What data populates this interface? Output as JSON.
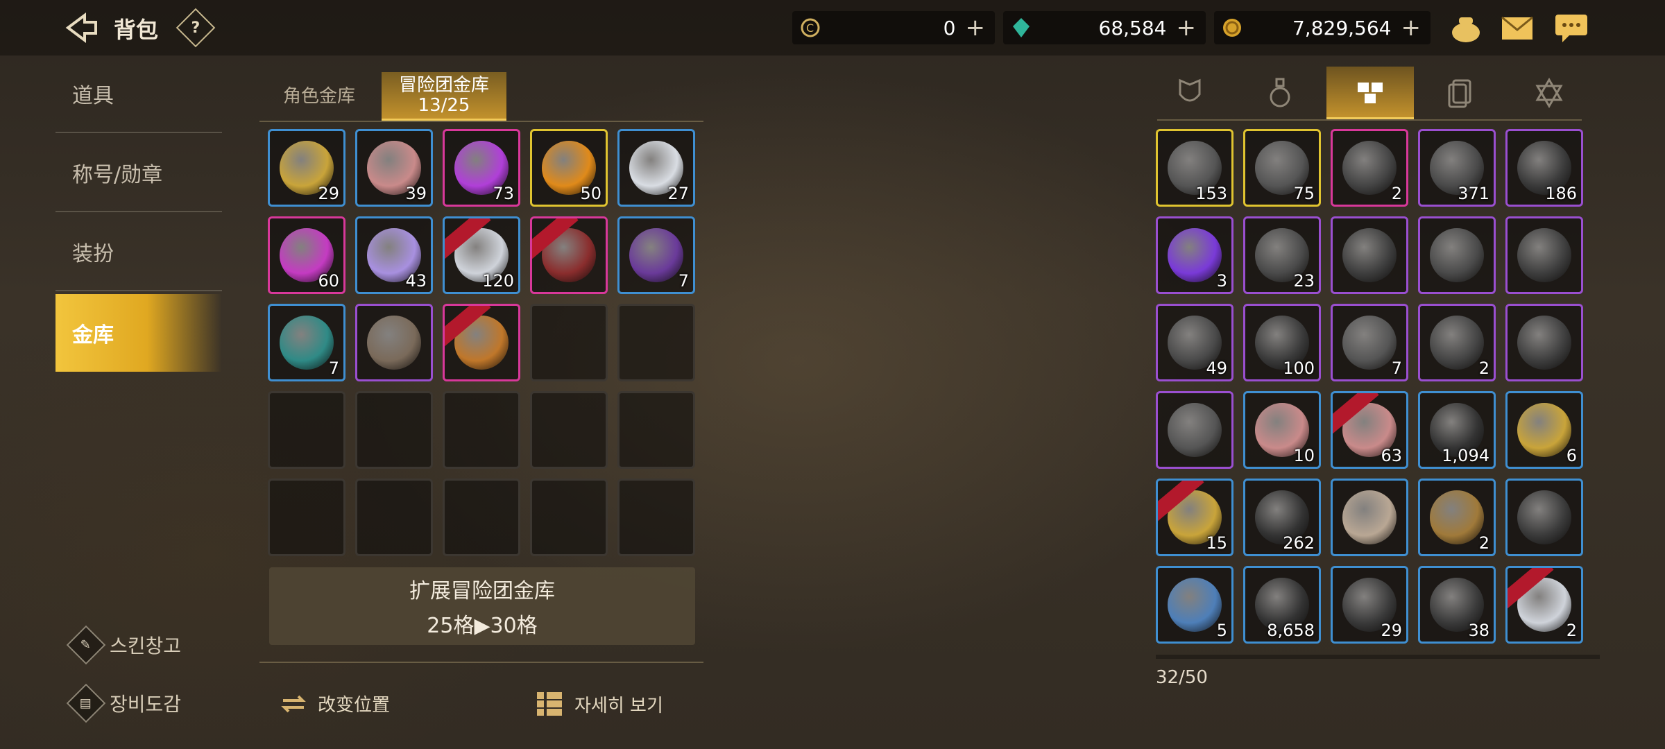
{
  "header": {
    "title": "背包",
    "help": "?",
    "currencies": [
      {
        "icon": "c-coin-icon",
        "value": "0"
      },
      {
        "icon": "green-gem-icon",
        "value": "68,584"
      },
      {
        "icon": "gold-coin-icon",
        "value": "7,829,564"
      }
    ],
    "plus": "+",
    "right_icons": [
      "pouch-icon",
      "mail-icon",
      "chat-icon"
    ]
  },
  "sidebar": {
    "items": [
      {
        "label": "道具"
      },
      {
        "label": "称号/勋章"
      },
      {
        "label": "装扮"
      },
      {
        "label": "金库"
      }
    ],
    "links": [
      {
        "label": "스킨창고",
        "icon": "brush-icon"
      },
      {
        "label": "장비도감",
        "icon": "book-icon"
      }
    ]
  },
  "vault": {
    "tabs": [
      {
        "label": "角色金库",
        "sub": ""
      },
      {
        "label": "冒险团金库",
        "sub": "13/25"
      }
    ],
    "cells": [
      {
        "rarity": "blue",
        "count": "29",
        "color": "#c9a43a"
      },
      {
        "rarity": "blue",
        "count": "39",
        "color": "#c98a8a"
      },
      {
        "rarity": "pink",
        "count": "73",
        "color": "#b03fd8"
      },
      {
        "rarity": "yellow",
        "count": "50",
        "color": "#e08a1a"
      },
      {
        "rarity": "blue",
        "count": "27",
        "color": "#d9dde3"
      },
      {
        "rarity": "pink",
        "count": "60",
        "color": "#c43bc2"
      },
      {
        "rarity": "blue",
        "count": "43",
        "color": "#a890e0"
      },
      {
        "rarity": "blue",
        "count": "120",
        "color": "#cfd3da",
        "ribbon": true
      },
      {
        "rarity": "pink",
        "count": "",
        "color": "#8a2d2d",
        "ribbon": true
      },
      {
        "rarity": "blue",
        "count": "7",
        "color": "#6a3a9a"
      },
      {
        "rarity": "blue",
        "count": "7",
        "color": "#2f8a86"
      },
      {
        "rarity": "purple",
        "count": "",
        "color": "#7a6a5a"
      },
      {
        "rarity": "pink",
        "count": "",
        "color": "#c0772a",
        "ribbon": true
      },
      {
        "rarity": "empty"
      },
      {
        "rarity": "empty"
      },
      {
        "rarity": "empty"
      },
      {
        "rarity": "empty"
      },
      {
        "rarity": "empty"
      },
      {
        "rarity": "empty"
      },
      {
        "rarity": "empty"
      },
      {
        "rarity": "empty"
      },
      {
        "rarity": "empty"
      },
      {
        "rarity": "empty"
      },
      {
        "rarity": "empty"
      },
      {
        "rarity": "empty"
      }
    ],
    "expand_line1": "扩展冒险团金库",
    "expand_line2": "25格▶30格",
    "actions": {
      "move_label": "改变位置",
      "detail_label": "자세히 보기"
    }
  },
  "inventory": {
    "category_tabs": [
      "armor-icon",
      "potion-icon",
      "materials-icon",
      "cards-icon",
      "hexagram-icon"
    ],
    "active_category": 2,
    "cells": [
      {
        "rarity": "yellow",
        "count": "153",
        "color": "#555"
      },
      {
        "rarity": "yellow",
        "count": "75",
        "color": "#555"
      },
      {
        "rarity": "pink",
        "count": "2",
        "color": "#444"
      },
      {
        "rarity": "purple",
        "count": "371",
        "color": "#4a4a4a"
      },
      {
        "rarity": "purple",
        "count": "186",
        "color": "#3a3a3a"
      },
      {
        "rarity": "purple",
        "count": "3",
        "color": "#7a3ad8"
      },
      {
        "rarity": "purple",
        "count": "23",
        "color": "#4a4a4a"
      },
      {
        "rarity": "purple",
        "count": "",
        "color": "#3e3e3e"
      },
      {
        "rarity": "purple",
        "count": "",
        "color": "#4a4a4a"
      },
      {
        "rarity": "purple",
        "count": "",
        "color": "#3e3e3e"
      },
      {
        "rarity": "purple",
        "count": "49",
        "color": "#4a4a4a"
      },
      {
        "rarity": "purple",
        "count": "100",
        "color": "#3a3a3a"
      },
      {
        "rarity": "purple",
        "count": "7",
        "color": "#555"
      },
      {
        "rarity": "purple",
        "count": "2",
        "color": "#444"
      },
      {
        "rarity": "purple",
        "count": "",
        "color": "#3e3e3e"
      },
      {
        "rarity": "purple",
        "count": "",
        "color": "#555"
      },
      {
        "rarity": "blue",
        "count": "10",
        "color": "#c98a8a"
      },
      {
        "rarity": "blue",
        "count": "63",
        "color": "#c98a8a",
        "ribbon": true
      },
      {
        "rarity": "blue",
        "count": "1,094",
        "color": "#333"
      },
      {
        "rarity": "blue",
        "count": "6",
        "color": "#c9a43a"
      },
      {
        "rarity": "blue",
        "count": "15",
        "color": "#c9a43a",
        "ribbon": true
      },
      {
        "rarity": "blue",
        "count": "262",
        "color": "#333"
      },
      {
        "rarity": "blue",
        "count": "",
        "color": "#b9a794"
      },
      {
        "rarity": "blue",
        "count": "2",
        "color": "#a07a3a"
      },
      {
        "rarity": "blue",
        "count": "",
        "color": "#3a3a3a"
      },
      {
        "rarity": "blue",
        "count": "5",
        "color": "#4e7fb8"
      },
      {
        "rarity": "blue",
        "count": "8,658",
        "color": "#333"
      },
      {
        "rarity": "blue",
        "count": "29",
        "color": "#3a3a3a"
      },
      {
        "rarity": "blue",
        "count": "38",
        "color": "#3a3a3a"
      },
      {
        "rarity": "blue",
        "count": "2",
        "color": "#cfd3da",
        "ribbon": true
      }
    ],
    "slot_count": "32/50"
  }
}
